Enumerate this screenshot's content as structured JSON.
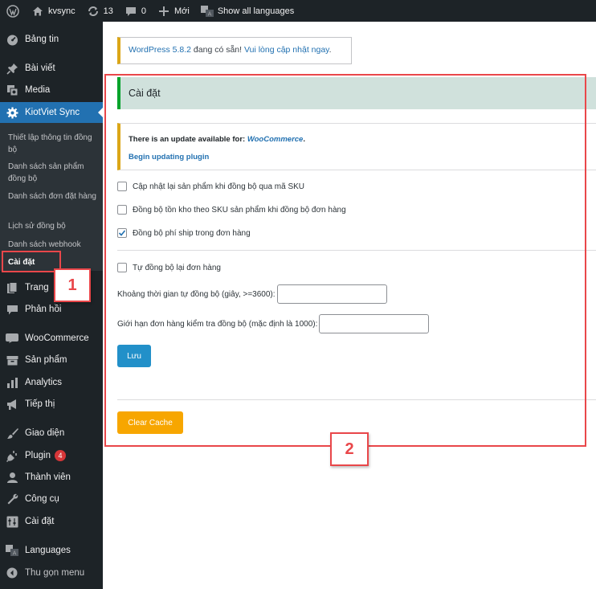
{
  "admin_bar": {
    "site_name": "kvsync",
    "updates_count": "13",
    "comments_count": "0",
    "new_label": "Mới",
    "languages_label": "Show all languages"
  },
  "sidebar": {
    "dashboard": "Bảng tin",
    "posts": "Bài viết",
    "media": "Media",
    "kiotviet": "KiotViet Sync",
    "submenu": {
      "setup": "Thiết lập thông tin đồng bộ",
      "products": "Danh sách sản phẩm đồng bộ",
      "orders": "Danh sách đơn đặt hàng",
      "history": "Lịch sử đồng bộ",
      "webhooks": "Danh sách webhook",
      "settings": "Cài đặt"
    },
    "pages": "Trang",
    "comments": "Phản hồi",
    "woocommerce": "WooCommerce",
    "products": "Sản phẩm",
    "analytics": "Analytics",
    "marketing": "Tiếp thị",
    "appearance": "Giao diện",
    "plugins": "Plugin",
    "plugins_badge": "4",
    "users": "Thành viên",
    "tools": "Công cụ",
    "settings": "Cài đặt",
    "languages": "Languages",
    "collapse": "Thu gọn menu"
  },
  "notice_wp": {
    "version_link": "WordPress 5.8.2",
    "text": " đang có sẵn! ",
    "update_link": "Vui lòng cập nhật ngay",
    "end": "."
  },
  "panel": {
    "title": "Cài đặt",
    "plugin_notice_text": "There is an update available for: ",
    "plugin_notice_link": "WooCommerce",
    "plugin_notice_end": ".",
    "begin_update": "Begin updating plugin",
    "options": [
      {
        "label": "Cập nhật lại sản phẩm khi đồng bộ qua mã SKU",
        "checked": false
      },
      {
        "label": "Đồng bộ tồn kho theo SKU sản phẩm khi đồng bộ đơn hàng",
        "checked": false
      },
      {
        "label": "Đồng bộ phí ship trong đơn hàng",
        "checked": true
      },
      {
        "label": "Tự đồng bộ lại đơn hàng",
        "checked": false
      }
    ],
    "interval_label": "Khoảng thời gian tự đồng bộ (giây, >=3600):",
    "interval_value": "",
    "limit_label": "Giới hạn đơn hàng kiểm tra đồng bộ (mặc định là 1000):",
    "limit_value": "",
    "save_button": "Lưu",
    "clear_cache_button": "Clear Cache"
  },
  "annotations": {
    "callout_1": "1",
    "callout_2": "2",
    "highlight_color": "#e9474a"
  }
}
